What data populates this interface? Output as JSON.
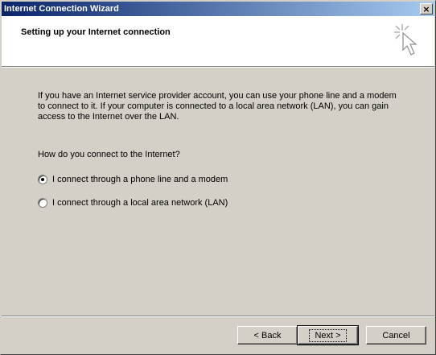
{
  "window": {
    "title": "Internet Connection Wizard",
    "close_glyph": "×"
  },
  "header": {
    "title": "Setting up your Internet connection",
    "icon": "wizard-cursor-sparkle-icon"
  },
  "content": {
    "description": "If you have an Internet service provider account, you can use your phone line and a modem to connect to it. If your computer is connected to a local area network (LAN), you can gain access to the Internet over the LAN.",
    "question": "How do you connect to the Internet?",
    "options": [
      {
        "label": "I connect through a phone line and a modem",
        "checked": true
      },
      {
        "label": "I connect through a local area network (LAN)",
        "checked": false
      }
    ]
  },
  "buttons": {
    "back": "< Back",
    "next": "Next >",
    "cancel": "Cancel"
  },
  "colors": {
    "titlebar_start": "#0a246a",
    "titlebar_end": "#a6caf0",
    "face": "#d4d0c8"
  }
}
